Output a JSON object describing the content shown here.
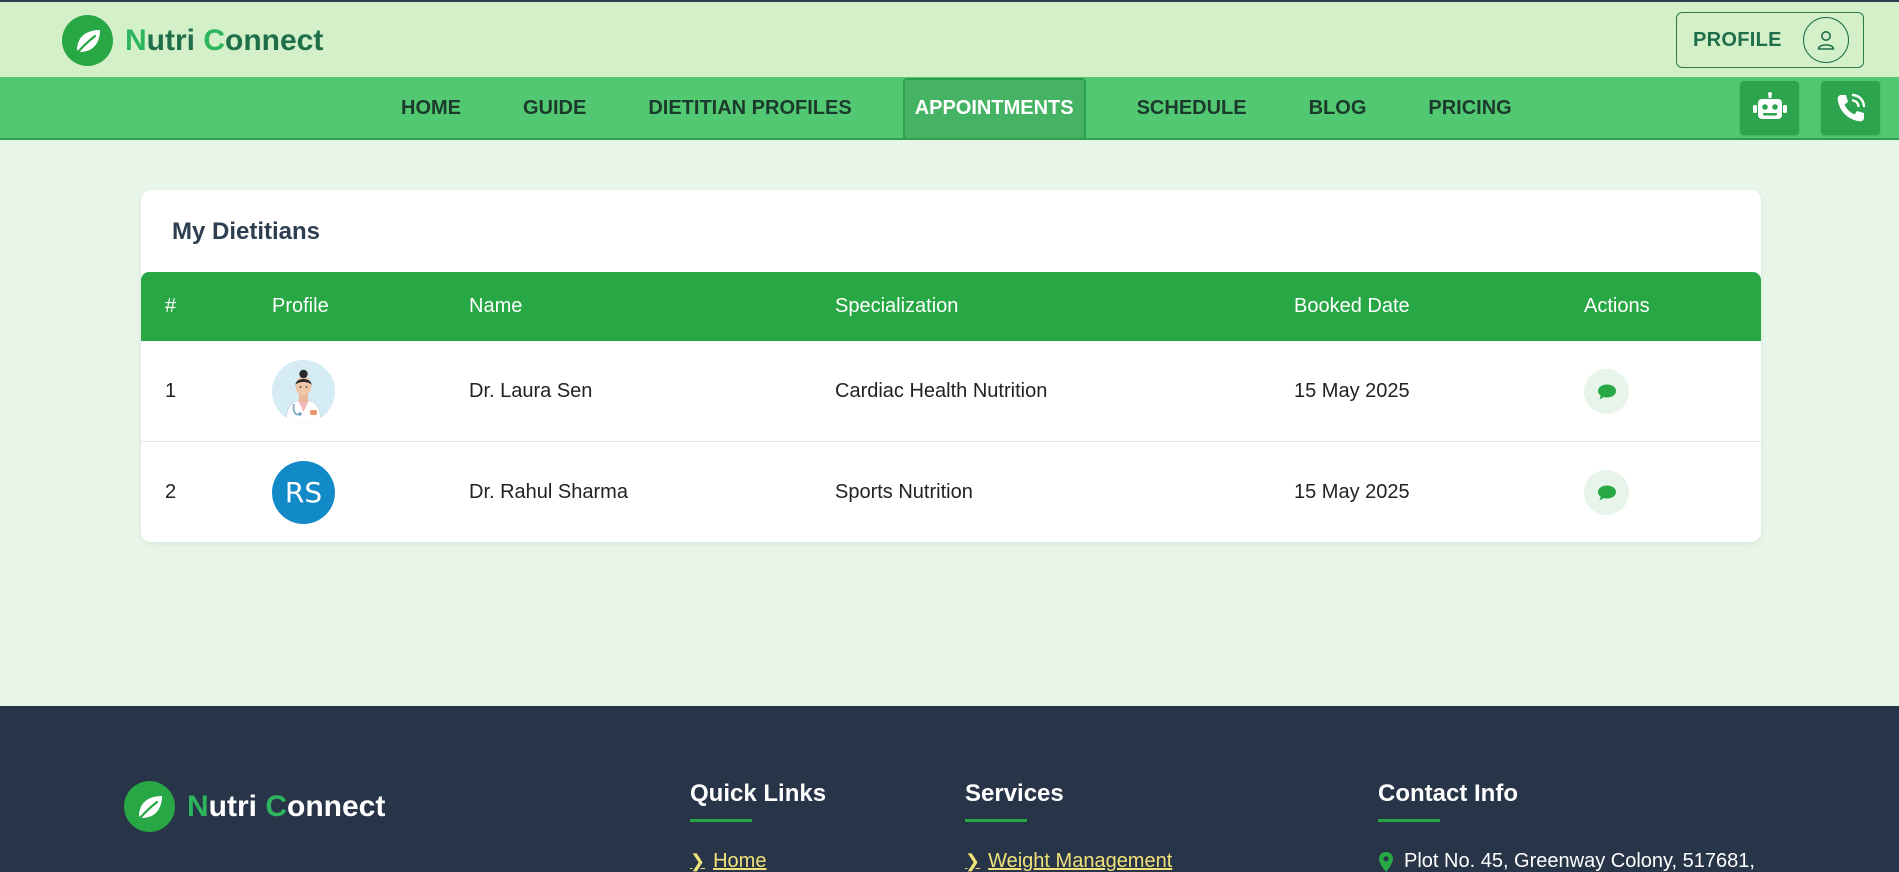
{
  "brand": {
    "first_letter": "N",
    "first_rest": "utri ",
    "second_letter": "C",
    "second_rest": "onnect"
  },
  "header": {
    "profile_label": "PROFILE"
  },
  "nav": {
    "items": [
      "HOME",
      "GUIDE",
      "DIETITIAN PROFILES",
      "APPOINTMENTS",
      "SCHEDULE",
      "BLOG",
      "PRICING"
    ],
    "active": "APPOINTMENTS",
    "icons": [
      "robot-icon",
      "phone-icon"
    ]
  },
  "card": {
    "title": "My Dietitians",
    "columns": [
      "#",
      "Profile",
      "Name",
      "Specialization",
      "Booked Date",
      "Actions"
    ],
    "rows": [
      {
        "index": "1",
        "avatar": "photo",
        "name": "Dr. Laura Sen",
        "specialization": "Cardiac Health Nutrition",
        "booked_date": "15 May 2025",
        "action_icon": "chat-icon"
      },
      {
        "index": "2",
        "avatar": "RS",
        "name": "Dr. Rahul Sharma",
        "specialization": "Sports Nutrition",
        "booked_date": "15 May 2025",
        "action_icon": "chat-icon"
      }
    ]
  },
  "footer": {
    "quick_links_title": "Quick Links",
    "quick_links": [
      "Home"
    ],
    "services_title": "Services",
    "services": [
      "Weight Management"
    ],
    "contact_title": "Contact Info",
    "contact_address": "Plot No. 45, Greenway Colony, 517681,"
  },
  "colors": {
    "primary_green": "#28a745",
    "nav_green": "#52c872",
    "header_bg": "#d3f0c9",
    "page_bg": "#e8f5e9",
    "footer_bg": "#283548",
    "footer_link": "#f1e27a"
  }
}
